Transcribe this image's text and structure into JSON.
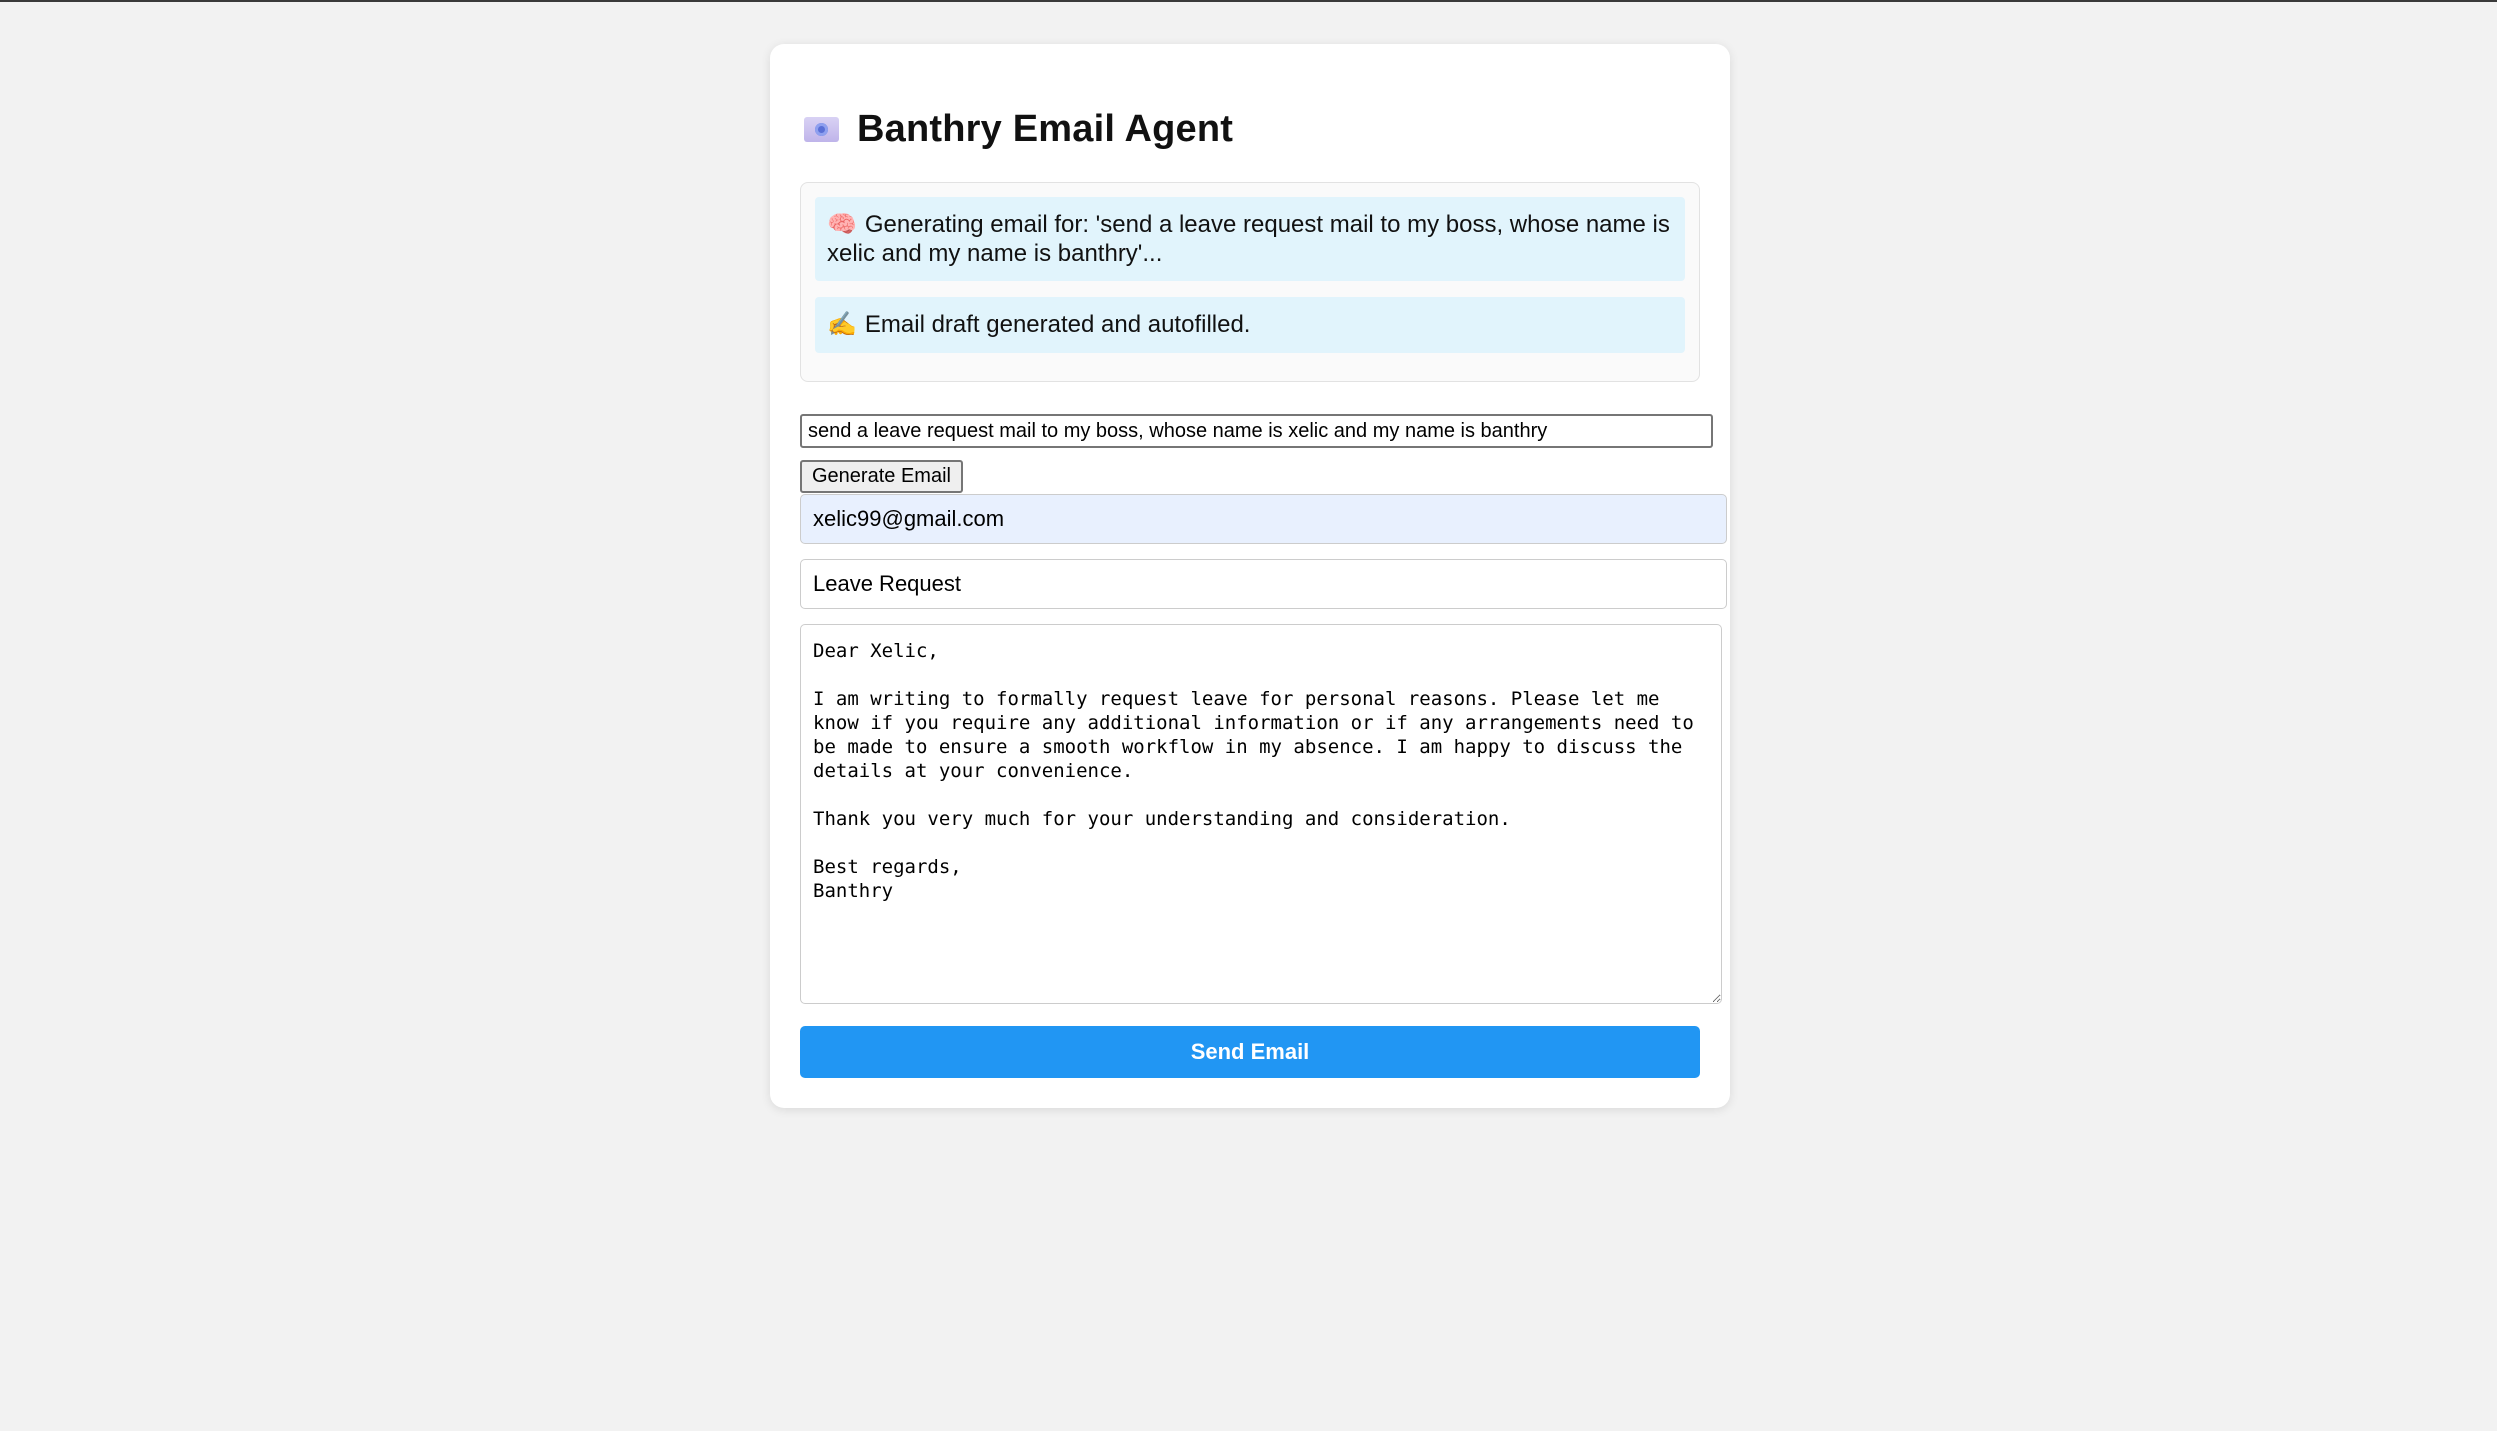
{
  "app": {
    "title": "Banthry Email Agent",
    "title_icon": "envelope-icon"
  },
  "log": {
    "entries": [
      {
        "icon": "brain-icon",
        "emoji": "🧠",
        "text": "Generating email for: 'send a leave request mail to my boss, whose name is xelic and my name is banthry'..."
      },
      {
        "icon": "writing-hand-icon",
        "emoji": "✍️",
        "text": "Email draft generated and autofilled."
      }
    ]
  },
  "prompt": {
    "value": "send a leave request mail to my boss, whose name is xelic and my name is banthry"
  },
  "generate_button": {
    "label": "Generate Email"
  },
  "email": {
    "to": "xelic99@gmail.com",
    "subject": "Leave Request",
    "body": "Dear Xelic,\n\nI am writing to formally request leave for personal reasons. Please let me know if you require any additional information or if any arrangements need to be made to ensure a smooth workflow in my absence. I am happy to discuss the details at your convenience.\n\nThank you very much for your understanding and consideration.\n\nBest regards,\nBanthry"
  },
  "send_button": {
    "label": "Send Email"
  },
  "colors": {
    "page_background": "#f2f2f2",
    "log_entry_background": "#e1f4fc",
    "autofill_background": "#e8f0fe",
    "send_button": "#2196f3"
  }
}
